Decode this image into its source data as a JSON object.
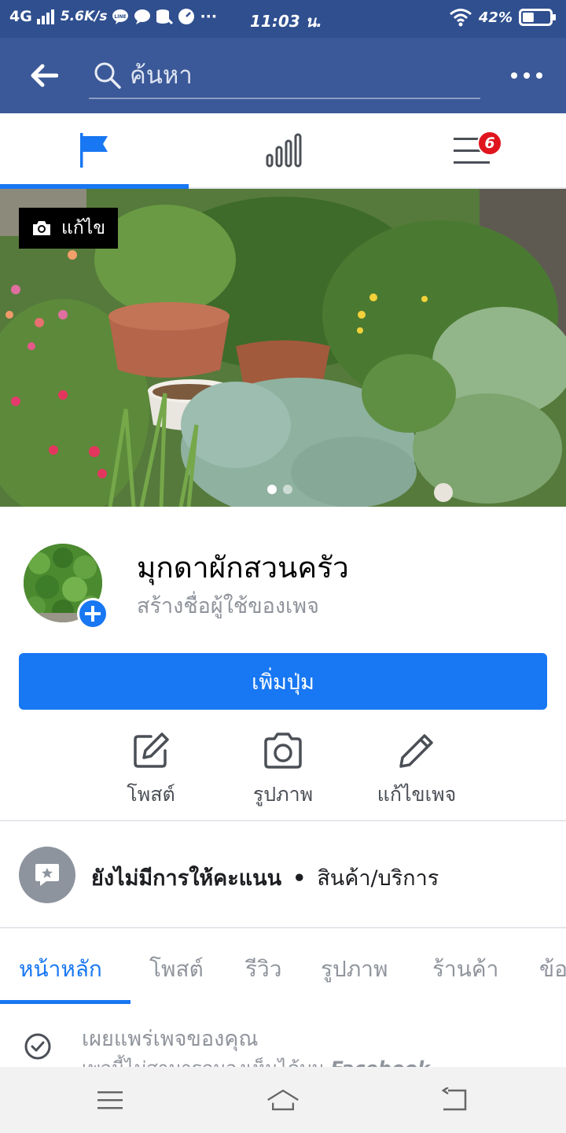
{
  "status_bar": {
    "network": "4G",
    "speed": "5.6K/s",
    "time": "11:03 น.",
    "battery": "42%",
    "battery_level": 0.42,
    "more": "···"
  },
  "header": {
    "search_placeholder": "ค้นหา"
  },
  "top_tabs": {
    "notification_count": "6",
    "active_index": 0
  },
  "cover": {
    "edit_label": "แก้ไข",
    "slide_count": 2,
    "active_slide": 0
  },
  "profile": {
    "name": "มุกดาผักสวนครัว",
    "username_hint": "สร้างชื่อผู้ใช้ของเพจ"
  },
  "add_button_label": "เพิ่มปุ่ม",
  "actions": [
    {
      "label": "โพสต์",
      "icon": "compose-icon"
    },
    {
      "label": "รูปภาพ",
      "icon": "camera-icon"
    },
    {
      "label": "แก้ไขเพจ",
      "icon": "pencil-icon"
    }
  ],
  "rating": {
    "text": "ยังไม่มีการให้คะแนน",
    "separator": "•",
    "category": "สินค้า/บริการ"
  },
  "page_tabs": [
    {
      "label": "หน้าหลัก",
      "active": true
    },
    {
      "label": "โพสต์",
      "active": false
    },
    {
      "label": "รีวิว",
      "active": false
    },
    {
      "label": "รูปภาพ",
      "active": false
    },
    {
      "label": "ร้านค้า",
      "active": false
    },
    {
      "label": "ข้อ",
      "active": false
    }
  ],
  "publish": {
    "title": "เผยแพร่เพจของคุณ",
    "subtitle": "เพจนี้ไม่สามารถมองเห็นได้บน",
    "subtitle_brand": "Facebook"
  },
  "colors": {
    "header_blue": "#3b5998",
    "accent_blue": "#1877f2",
    "badge_red": "#e0151d"
  }
}
